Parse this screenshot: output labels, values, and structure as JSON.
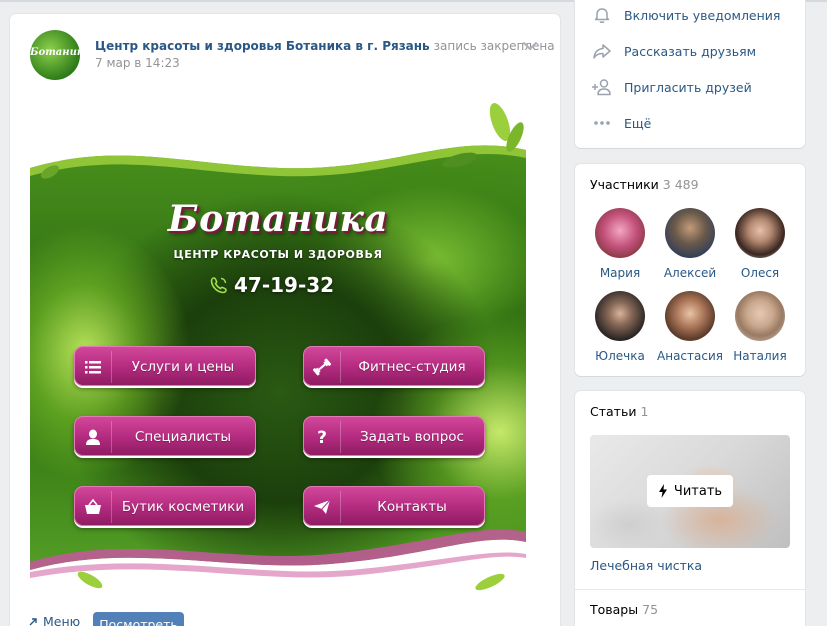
{
  "post": {
    "author": "Центр красоты и здоровья Ботаника в г. Рязань",
    "pinned_text": "запись закреплена",
    "date": "7 мар в 14:23",
    "avatar_logo": "Ботаника",
    "banner": {
      "brand": "Ботаника",
      "subtitle": "ЦЕНТР КРАСОТЫ И ЗДОРОВЬЯ",
      "phone": "47-19-32",
      "buttons": [
        {
          "label": "Услуги и цены",
          "icon": "list-icon"
        },
        {
          "label": "Фитнес-студия",
          "icon": "dumbbell-icon"
        },
        {
          "label": "Специалисты",
          "icon": "person-icon"
        },
        {
          "label": "Задать вопрос",
          "icon": "question-icon"
        },
        {
          "label": "Бутик косметики",
          "icon": "basket-icon"
        },
        {
          "label": "Контакты",
          "icon": "send-icon"
        }
      ]
    },
    "menu_link": "Меню",
    "view_button": "Посмотреть"
  },
  "actions": [
    {
      "label": "Включить уведомления",
      "icon": "bell-icon"
    },
    {
      "label": "Рассказать друзьям",
      "icon": "share-icon"
    },
    {
      "label": "Пригласить друзей",
      "icon": "invite-user-icon"
    },
    {
      "label": "Ещё",
      "icon": "more-icon"
    }
  ],
  "members": {
    "title": "Участники",
    "count": "3 489",
    "list": [
      {
        "name": "Мария",
        "color": "#c2507a"
      },
      {
        "name": "Алексей",
        "color": "#6a5a4a"
      },
      {
        "name": "Олеся",
        "color": "#6b4a3c"
      },
      {
        "name": "Юлечка",
        "color": "#3e3a36"
      },
      {
        "name": "Анастасия",
        "color": "#7a5a48"
      },
      {
        "name": "Наталия",
        "color": "#9a8a7a"
      }
    ]
  },
  "articles": {
    "title": "Статьи",
    "count": "1",
    "read_button": "Читать",
    "item_title": "Лечебная чистка"
  },
  "goods": {
    "title": "Товары",
    "count": "75"
  },
  "colors": {
    "link": "#2a5885",
    "accent": "#5181b8",
    "menu_button": "#b22a7e",
    "muted": "#939393"
  }
}
